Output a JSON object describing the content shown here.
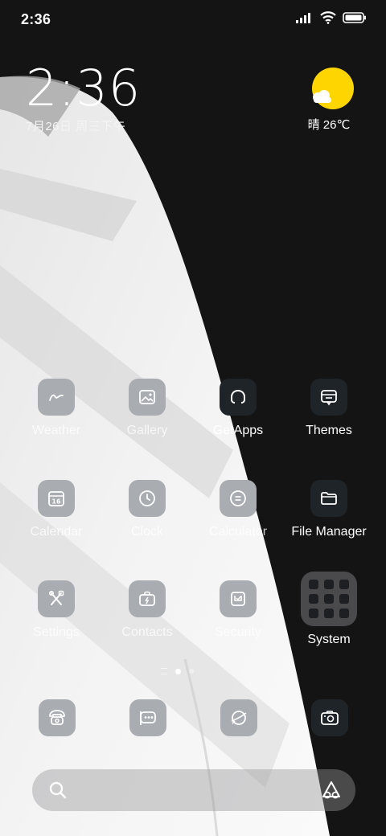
{
  "status_bar": {
    "time": "2:36",
    "icons": [
      "signal-icon",
      "wifi-icon",
      "battery-icon"
    ]
  },
  "clock_widget": {
    "time": "2:36",
    "date": "7月26日 周三下午"
  },
  "weather_widget": {
    "icon": "sunny-cloud-icon",
    "text": "晴 26℃"
  },
  "apps": [
    {
      "label": "Weather",
      "icon": "weather-icon"
    },
    {
      "label": "Gallery",
      "icon": "gallery-icon"
    },
    {
      "label": "GetApps",
      "icon": "getapps-icon"
    },
    {
      "label": "Themes",
      "icon": "themes-icon"
    },
    {
      "label": "Calendar",
      "icon": "calendar-icon",
      "icon_text": "16"
    },
    {
      "label": "Clock",
      "icon": "clock-icon"
    },
    {
      "label": "Calculator",
      "icon": "calculator-icon"
    },
    {
      "label": "File Manager",
      "icon": "folder-icon"
    },
    {
      "label": "Settings",
      "icon": "settings-icon"
    },
    {
      "label": "Contacts",
      "icon": "contacts-icon"
    },
    {
      "label": "Security",
      "icon": "security-icon"
    },
    {
      "label": "System",
      "icon": "system-folder-icon"
    }
  ],
  "page_indicator": {
    "pages": 2,
    "current": 1
  },
  "dock": [
    {
      "icon": "phone-icon"
    },
    {
      "icon": "messages-icon"
    },
    {
      "icon": "browser-icon"
    },
    {
      "icon": "camera-icon"
    }
  ],
  "search_bar": {
    "placeholder": ""
  },
  "colors": {
    "background": "#141414",
    "wallpaper_light": "#f0f0f0",
    "icon_light": "#a9adb2",
    "icon_dark": "#1f2429",
    "sun": "#ffd500",
    "folder": "#4a4a4c"
  }
}
